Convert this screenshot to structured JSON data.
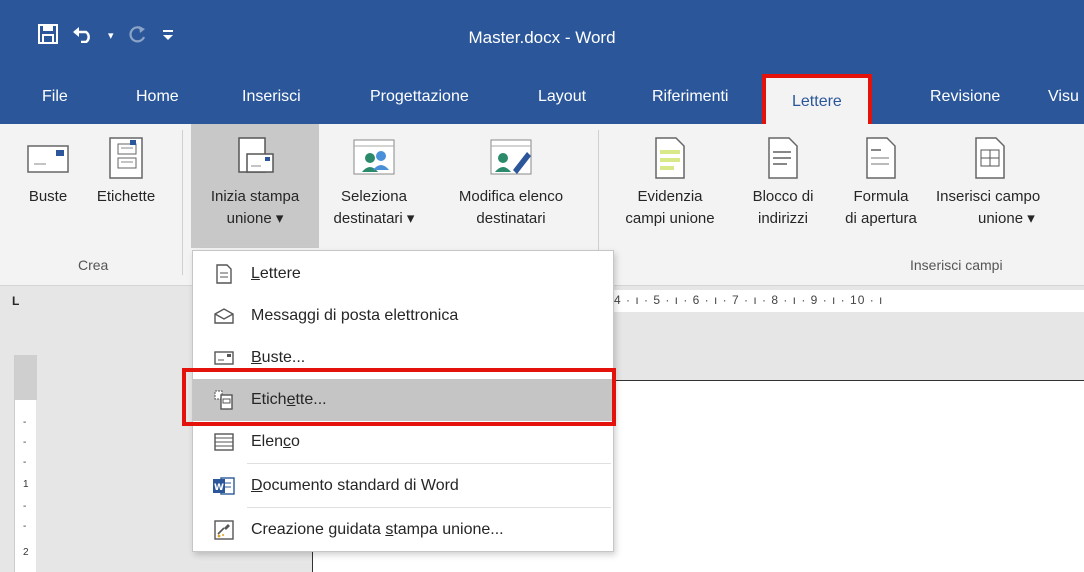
{
  "window": {
    "title": "Master.docx - Word"
  },
  "qat": {
    "save_icon": "save-icon",
    "undo_icon": "undo-icon",
    "redo_icon": "redo-icon",
    "customize_icon": "customize-qat-icon"
  },
  "tabs": [
    {
      "label": "File"
    },
    {
      "label": "Home"
    },
    {
      "label": "Inserisci"
    },
    {
      "label": "Progettazione"
    },
    {
      "label": "Layout"
    },
    {
      "label": "Riferimenti"
    },
    {
      "label": "Lettere"
    },
    {
      "label": "Revisione"
    },
    {
      "label": "Visu"
    }
  ],
  "ribbon": {
    "buste": "Buste",
    "etichette": "Etichette",
    "inizia_l1": "Inizia stampa",
    "inizia_l2": "unione ▾",
    "seleziona_l1": "Seleziona",
    "seleziona_l2": "destinatari ▾",
    "modifica_l1": "Modifica elenco",
    "modifica_l2": "destinatari",
    "evidenzia_l1": "Evidenzia",
    "evidenzia_l2": "campi unione",
    "blocco_l1": "Blocco di",
    "blocco_l2": "indirizzi",
    "formula_l1": "Formula",
    "formula_l2": "di apertura",
    "inserisci_l1": "Inserisci campo",
    "inserisci_l2": "unione ▾",
    "group_crea": "Crea",
    "group_inserisci": "Inserisci campi"
  },
  "ruler": {
    "corner": "L",
    "horizontal": "4 · ı · 5 · ı · 6 · ı · 7 · ı · 8 · ı · 9 · ı · 10 · ı",
    "vertical_ticks": [
      "-",
      "-",
      "-",
      "1",
      "-",
      "-",
      "2"
    ]
  },
  "menu": {
    "items": [
      {
        "pre": "",
        "ul": "L",
        "post": "ettere"
      },
      {
        "pre": "Messag",
        "ul": "g",
        "post": "i di posta elettronica"
      },
      {
        "pre": "",
        "ul": "B",
        "post": "uste..."
      },
      {
        "pre": "Etich",
        "ul": "e",
        "post": "tte..."
      },
      {
        "pre": "Elen",
        "ul": "c",
        "post": "o"
      },
      {
        "pre": "",
        "ul": "D",
        "post": "ocumento standard di Word"
      },
      {
        "pre": "Creazione guidata ",
        "ul": "s",
        "post": "tampa unione..."
      }
    ]
  },
  "colors": {
    "title_bar": "#2b579a",
    "highlight_border": "#e3120b"
  }
}
